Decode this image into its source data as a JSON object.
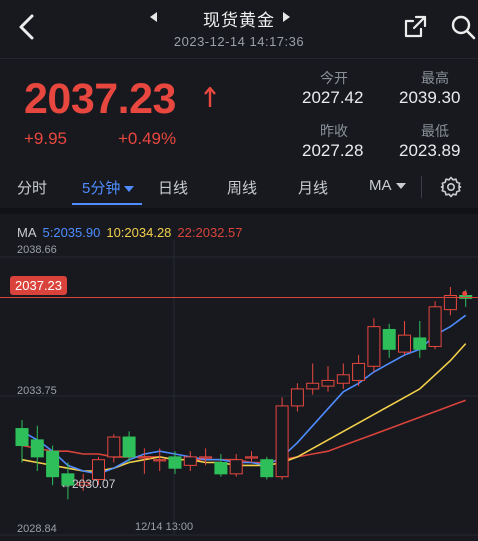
{
  "header": {
    "title": "现货黄金",
    "datetime": "2023-12-14 14:17:36"
  },
  "quote": {
    "price": "2037.23",
    "change": "+9.95",
    "change_pct": "+0.49%",
    "stats": [
      {
        "label": "今开",
        "value": "2027.42"
      },
      {
        "label": "最高",
        "value": "2039.30"
      },
      {
        "label": "昨收",
        "value": "2027.28"
      },
      {
        "label": "最低",
        "value": "2023.89"
      }
    ]
  },
  "tabs": [
    "分时",
    "5分钟",
    "日线",
    "周线",
    "月线",
    "MA"
  ],
  "active_tab": "5分钟",
  "ma_legend": {
    "label": "MA",
    "ma5": "5:2035.90",
    "ma10": "10:2034.28",
    "ma22": "22:2032.57"
  },
  "colors": {
    "up": "#e8473f",
    "down": "#2fbf5a",
    "accent": "#4e8cff",
    "ma5": "#4e8cff",
    "ma10": "#f2d04b",
    "ma22": "#d9433b"
  },
  "icons": [
    "back-icon",
    "prev-icon",
    "next-icon",
    "share-icon",
    "search-icon",
    "up-arrow-icon",
    "caret-down-icon",
    "settings-icon"
  ],
  "chart_data": {
    "type": "candlestick",
    "y_labels": [
      "2038.66",
      "2033.75",
      "2028.84"
    ],
    "x_labels": [
      "12/14 13:00"
    ],
    "ylim": [
      2028.84,
      2038.66
    ],
    "current_price": "2037.23",
    "min_annotation": "←2030.07",
    "candles": [
      {
        "o": 2032.6,
        "c": 2032.0,
        "h": 2032.9,
        "l": 2031.4
      },
      {
        "o": 2032.2,
        "c": 2031.6,
        "h": 2032.7,
        "l": 2031.1
      },
      {
        "o": 2031.8,
        "c": 2030.9,
        "h": 2032.0,
        "l": 2030.6
      },
      {
        "o": 2031.0,
        "c": 2030.6,
        "h": 2031.4,
        "l": 2030.1
      },
      {
        "o": 2030.6,
        "c": 2030.7,
        "h": 2031.0,
        "l": 2030.4
      },
      {
        "o": 2030.8,
        "c": 2031.5,
        "h": 2031.6,
        "l": 2030.6
      },
      {
        "o": 2031.6,
        "c": 2032.3,
        "h": 2032.4,
        "l": 2031.4
      },
      {
        "o": 2032.3,
        "c": 2031.6,
        "h": 2032.5,
        "l": 2031.4
      },
      {
        "o": 2031.6,
        "c": 2031.6,
        "h": 2031.9,
        "l": 2031.0
      },
      {
        "o": 2031.5,
        "c": 2031.5,
        "h": 2031.9,
        "l": 2031.1
      },
      {
        "o": 2031.6,
        "c": 2031.2,
        "h": 2031.8,
        "l": 2031.0
      },
      {
        "o": 2031.3,
        "c": 2031.6,
        "h": 2031.8,
        "l": 2031.1
      },
      {
        "o": 2031.6,
        "c": 2031.6,
        "h": 2031.9,
        "l": 2031.3
      },
      {
        "o": 2031.4,
        "c": 2031.0,
        "h": 2031.7,
        "l": 2030.9
      },
      {
        "o": 2031.0,
        "c": 2031.5,
        "h": 2031.7,
        "l": 2030.9
      },
      {
        "o": 2031.6,
        "c": 2031.6,
        "h": 2031.8,
        "l": 2031.4
      },
      {
        "o": 2031.5,
        "c": 2030.9,
        "h": 2031.6,
        "l": 2030.8
      },
      {
        "o": 2030.9,
        "c": 2033.4,
        "h": 2033.7,
        "l": 2030.8
      },
      {
        "o": 2033.4,
        "c": 2034.0,
        "h": 2034.2,
        "l": 2033.2
      },
      {
        "o": 2034.0,
        "c": 2034.2,
        "h": 2034.9,
        "l": 2033.8
      },
      {
        "o": 2034.1,
        "c": 2034.3,
        "h": 2034.8,
        "l": 2033.9
      },
      {
        "o": 2034.2,
        "c": 2034.5,
        "h": 2034.9,
        "l": 2034.0
      },
      {
        "o": 2034.3,
        "c": 2034.9,
        "h": 2035.2,
        "l": 2034.1
      },
      {
        "o": 2034.8,
        "c": 2036.2,
        "h": 2036.5,
        "l": 2034.6
      },
      {
        "o": 2036.1,
        "c": 2035.4,
        "h": 2036.3,
        "l": 2035.1
      },
      {
        "o": 2035.3,
        "c": 2035.9,
        "h": 2036.4,
        "l": 2035.2
      },
      {
        "o": 2035.8,
        "c": 2035.4,
        "h": 2036.4,
        "l": 2035.1
      },
      {
        "o": 2035.5,
        "c": 2036.9,
        "h": 2037.1,
        "l": 2035.4
      },
      {
        "o": 2036.8,
        "c": 2037.3,
        "h": 2037.6,
        "l": 2036.6
      },
      {
        "o": 2037.3,
        "c": 2037.2,
        "h": 2037.5,
        "l": 2036.9
      }
    ],
    "ma5": [
      2032.5,
      2032.2,
      2031.8,
      2031.3,
      2031.1,
      2031.0,
      2031.2,
      2031.5,
      2031.7,
      2031.8,
      2031.7,
      2031.6,
      2031.5,
      2031.5,
      2031.4,
      2031.4,
      2031.3,
      2031.6,
      2032.1,
      2032.7,
      2033.3,
      2033.9,
      2034.2,
      2034.6,
      2034.9,
      2035.2,
      2035.4,
      2035.9,
      2036.2,
      2036.6
    ],
    "ma10": [
      2031.5,
      2031.4,
      2031.3,
      2031.2,
      2031.1,
      2031.1,
      2031.2,
      2031.4,
      2031.5,
      2031.6,
      2031.5,
      2031.5,
      2031.4,
      2031.4,
      2031.3,
      2031.3,
      2031.3,
      2031.4,
      2031.6,
      2031.9,
      2032.2,
      2032.5,
      2032.8,
      2033.1,
      2033.4,
      2033.7,
      2034.0,
      2034.5,
      2035.0,
      2035.6
    ],
    "ma22": [
      2032.0,
      2031.9,
      2031.8,
      2031.8,
      2031.7,
      2031.7,
      2031.6,
      2031.6,
      2031.6,
      2031.6,
      2031.5,
      2031.5,
      2031.5,
      2031.5,
      2031.5,
      2031.4,
      2031.4,
      2031.5,
      2031.6,
      2031.7,
      2031.8,
      2032.0,
      2032.2,
      2032.4,
      2032.6,
      2032.8,
      2033.0,
      2033.2,
      2033.4,
      2033.6
    ]
  }
}
